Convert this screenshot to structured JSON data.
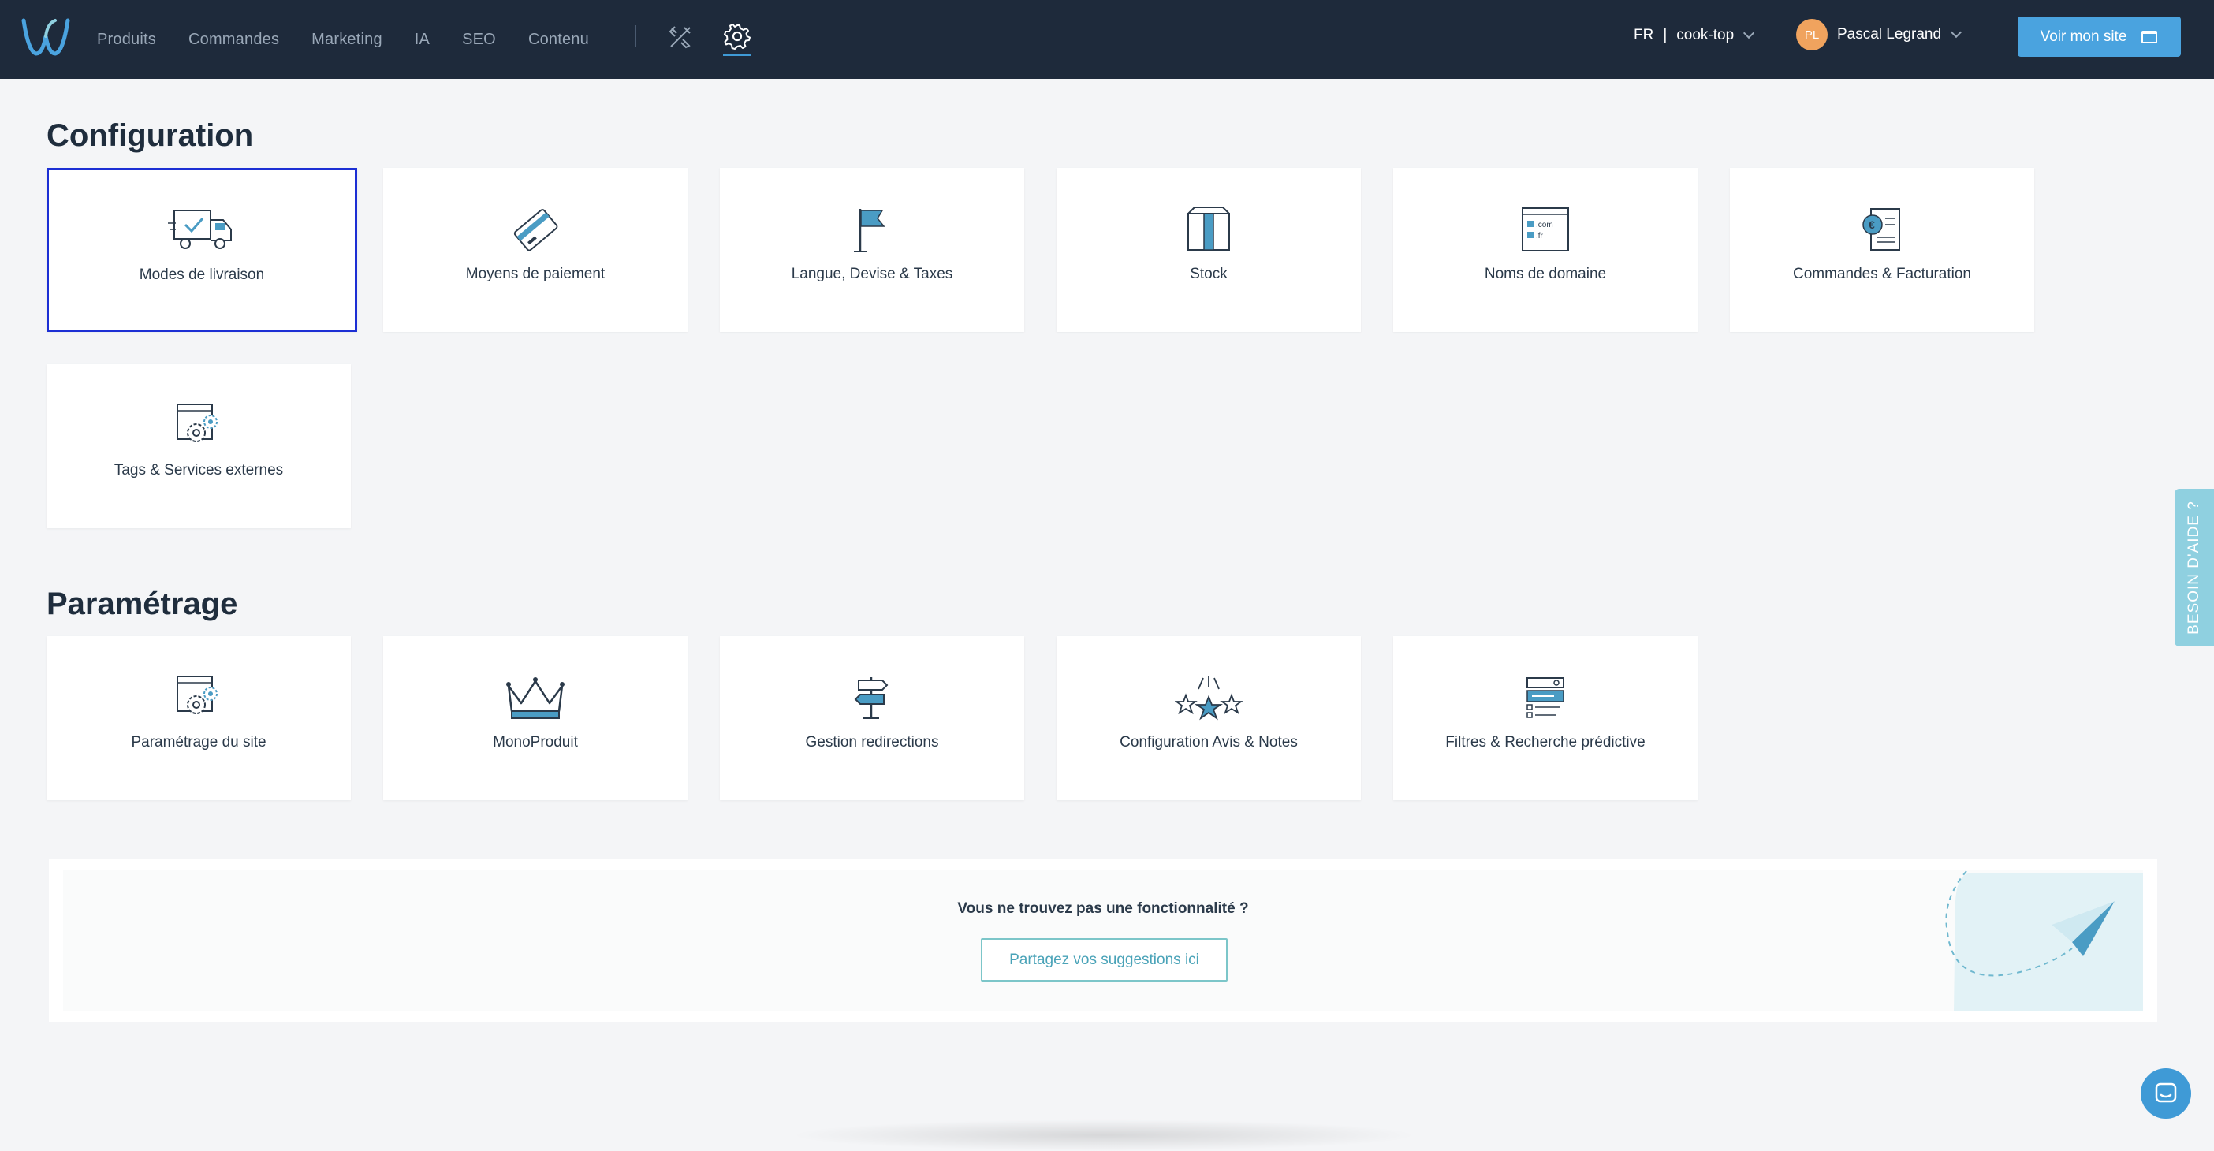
{
  "nav": {
    "items": [
      "Produits",
      "Commandes",
      "Marketing",
      "IA",
      "SEO",
      "Contenu"
    ],
    "tool_icon": "design-tools-icon",
    "settings_icon": "gear-icon"
  },
  "topbar": {
    "lang": "FR",
    "separator": "|",
    "site": "cook-top",
    "user_initials": "PL",
    "user_name": "Pascal Legrand",
    "voir_label": "Voir mon site"
  },
  "configuration": {
    "title": "Configuration",
    "cards": [
      {
        "label": "Modes de livraison",
        "icon": "delivery-truck-icon"
      },
      {
        "label": "Moyens de paiement",
        "icon": "credit-card-icon"
      },
      {
        "label": "Langue, Devise & Taxes",
        "icon": "flag-icon"
      },
      {
        "label": "Stock",
        "icon": "box-icon"
      },
      {
        "label": "Noms de domaine",
        "icon": "domain-names-icon",
        "icon_text": [
          ".com",
          ".fr"
        ]
      },
      {
        "label": "Commandes & Facturation",
        "icon": "invoice-euro-icon",
        "icon_text": "€"
      },
      {
        "label": "Tags & Services externes",
        "icon": "window-gear-icon"
      }
    ]
  },
  "parametrage": {
    "title": "Paramétrage",
    "cards": [
      {
        "label": "Paramétrage du site",
        "icon": "window-gear-icon"
      },
      {
        "label": "MonoProduit",
        "icon": "crown-icon"
      },
      {
        "label": "Gestion redirections",
        "icon": "signpost-icon"
      },
      {
        "label": "Configuration Avis & Notes",
        "icon": "stars-icon"
      },
      {
        "label": "Filtres & Recherche prédictive",
        "icon": "filter-search-icon"
      }
    ]
  },
  "banner": {
    "question": "Vous ne trouvez pas une fonctionnalité ?",
    "button": "Partagez vos suggestions ici"
  },
  "help": {
    "label": "BESOIN D'AIDE ?"
  },
  "colors": {
    "topbar": "#1e2a3b",
    "accent": "#4aa3df",
    "selected_border": "#1c2fd4",
    "avatar": "#f0a35e"
  }
}
